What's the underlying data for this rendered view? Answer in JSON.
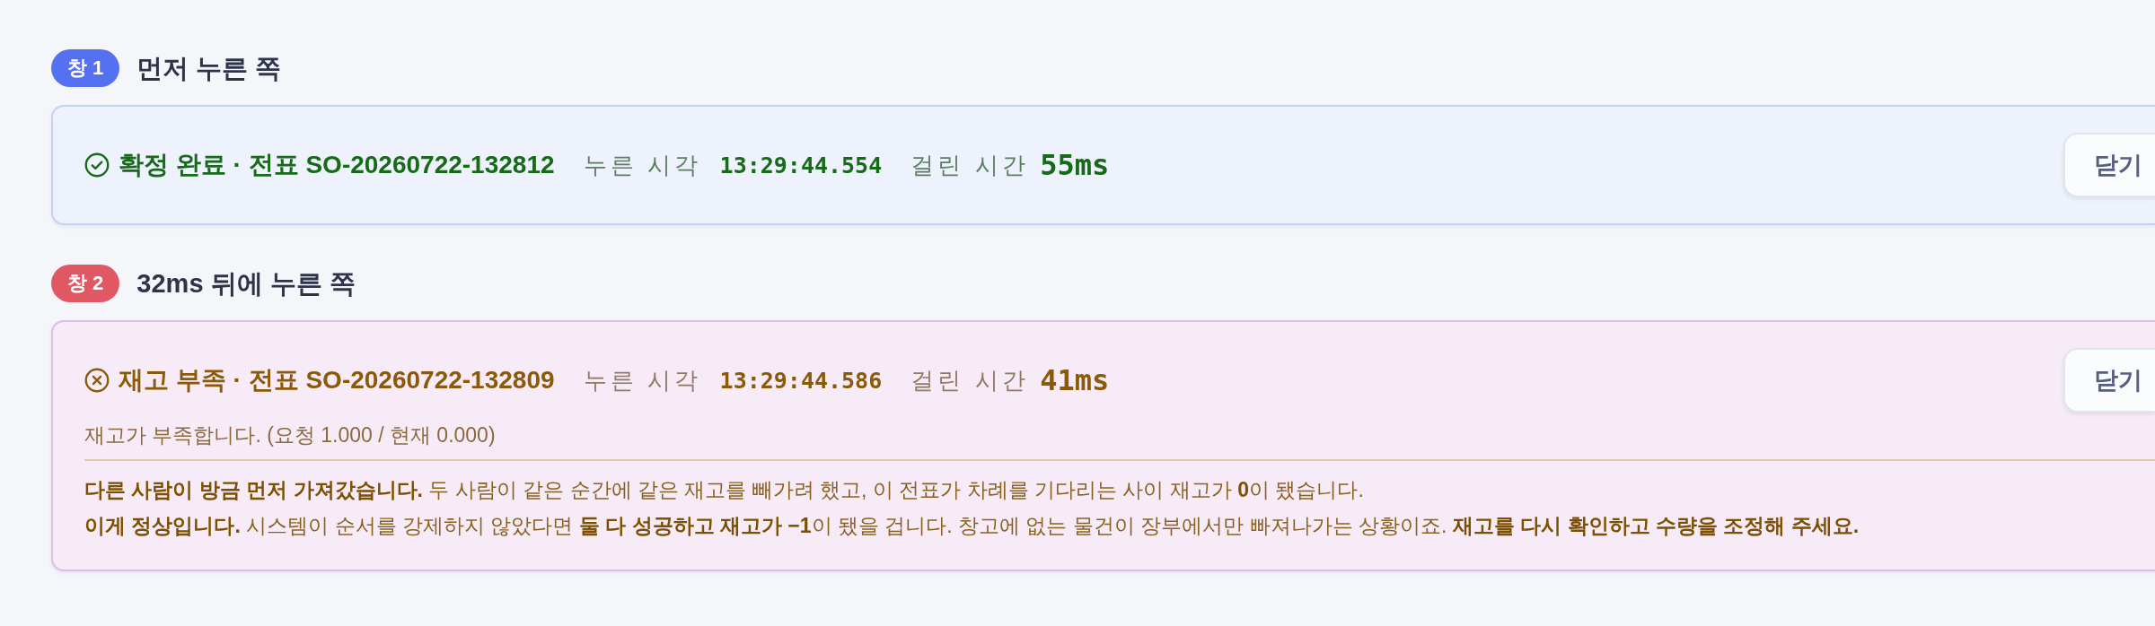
{
  "panels": [
    {
      "badge": "창 1",
      "title": "먼저 누른 쪽",
      "result": {
        "kind": "success",
        "heading": "확정 완료 · 전표 SO-20260722-132812",
        "pressed_label": "누른 시각",
        "pressed_time": "13:29:44.554",
        "elapsed_label": "걸린 시간",
        "elapsed": "55ms",
        "close_button": "닫기"
      }
    },
    {
      "badge": "창 2",
      "title": "32ms 뒤에 누른 쪽",
      "result": {
        "kind": "error",
        "heading": "재고 부족 · 전표 SO-20260722-132809",
        "pressed_label": "누른 시각",
        "pressed_time": "13:29:44.586",
        "elapsed_label": "걸린 시간",
        "elapsed": "41ms",
        "close_button": "닫기",
        "message": "재고가 부족합니다. (요청 1.000 / 현재 0.000)",
        "details": [
          "**다른 사람이 방금 먼저 가져갔습니다.** 두 사람이 같은 순간에 같은 재고를 빼가려 했고, 이 전표가 차례를 기다리는 사이 재고가 **0**이 됐습니다.",
          "**이게 정상입니다.** 시스템이 순서를 강제하지 않았다면 **둘 다 성공하고 재고가 −1**이 됐을 겁니다. 창고에 없는 물건이 장부에서만 빠져나가는 상황이죠. **재고를 다시 확인하고 수량을 조정해 주세요.**"
        ]
      }
    }
  ]
}
